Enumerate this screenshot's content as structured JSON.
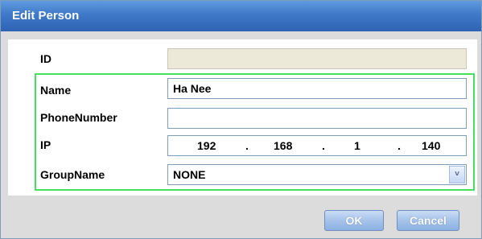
{
  "window": {
    "title": "Edit Person"
  },
  "form": {
    "id_label": "ID",
    "id_value": "",
    "name_label": "Name",
    "name_value": "Ha Nee",
    "phone_label": "PhoneNumber",
    "phone_value": "",
    "ip_label": "IP",
    "ip_octets": [
      "192",
      "168",
      "1",
      "140"
    ],
    "ip_separator": ".",
    "group_label": "GroupName",
    "group_value": "NONE",
    "group_dropdown_glyph": "˅"
  },
  "buttons": {
    "ok": "OK",
    "cancel": "Cancel"
  },
  "colors": {
    "highlight": "#44e060",
    "titlebar": "#3f79c7"
  }
}
